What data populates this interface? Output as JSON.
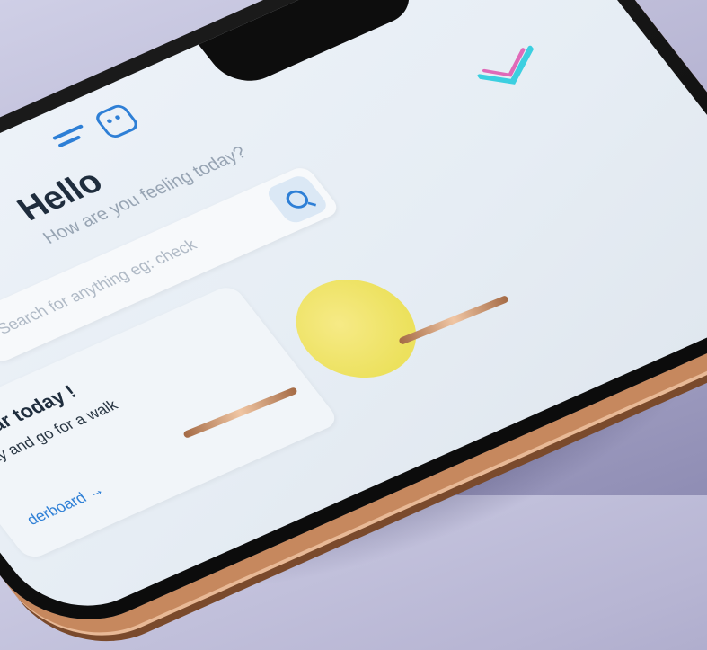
{
  "header": {
    "menu_icon": "menu-icon",
    "profile_icon": "bot-icon"
  },
  "greeting": {
    "title": "Hello",
    "subtitle": "How are you feeling today?"
  },
  "search": {
    "placeholder": "Search for anything eg: check",
    "button_icon": "search-icon"
  },
  "card": {
    "title": "Clear today !",
    "subtitle": "day and go for a walk",
    "link": "derboard →"
  },
  "colors": {
    "accent": "#2e7fd6",
    "highlight": "#ece15d",
    "frame_gold": "#c6885e",
    "background": "#b7b5d3"
  }
}
